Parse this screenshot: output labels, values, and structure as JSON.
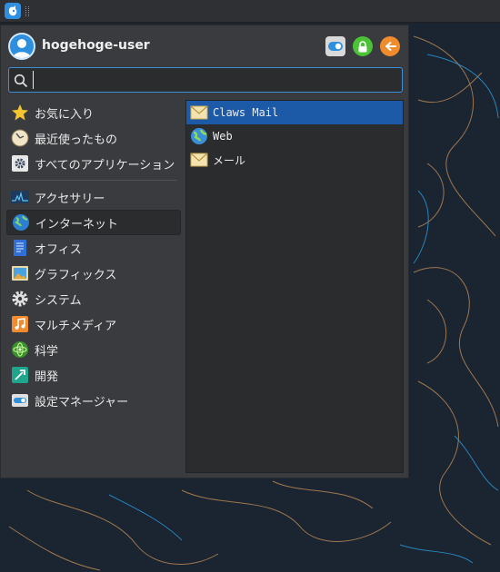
{
  "panel": {
    "menu_button_icon": "whisker-menu-icon"
  },
  "menu": {
    "username": "hogehoge-user",
    "header_buttons": [
      {
        "name": "settings-toggle-icon",
        "color": "#d9d9d9"
      },
      {
        "name": "lock-icon",
        "color": "#4cc236"
      },
      {
        "name": "logout-arrow-icon",
        "color": "#f08c2c"
      }
    ],
    "search": {
      "value": "",
      "placeholder": ""
    },
    "categories": [
      {
        "label": "お気に入り",
        "icon": "star-icon"
      },
      {
        "label": "最近使ったもの",
        "icon": "clock-icon"
      },
      {
        "label": "すべてのアプリケーション",
        "icon": "gear-icon"
      },
      {
        "label": "アクセサリー",
        "icon": "monitor-icon"
      },
      {
        "label": "インターネット",
        "icon": "globe-icon"
      },
      {
        "label": "オフィス",
        "icon": "document-icon"
      },
      {
        "label": "グラフィックス",
        "icon": "image-icon"
      },
      {
        "label": "システム",
        "icon": "cog-icon"
      },
      {
        "label": "マルチメディア",
        "icon": "music-icon"
      },
      {
        "label": "科学",
        "icon": "atom-icon"
      },
      {
        "label": "開発",
        "icon": "hammer-icon"
      },
      {
        "label": "設定マネージャー",
        "icon": "toggle-icon"
      }
    ],
    "active_category": "インターネット",
    "apps": [
      {
        "label": "Claws Mail",
        "icon": "envelope-icon"
      },
      {
        "label": "Web",
        "icon": "web-globe-icon"
      },
      {
        "label": "メール",
        "icon": "envelope-icon"
      }
    ],
    "selected_app": "Claws Mail"
  },
  "colors": {
    "accent": "#1c5aa8",
    "search_border": "#3f8fd6",
    "wallpaper": "#1b2431"
  }
}
